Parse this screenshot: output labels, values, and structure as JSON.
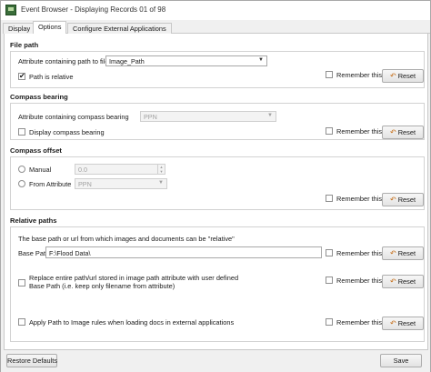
{
  "window": {
    "title": "Event Browser - Displaying Records 01 of 98",
    "app_icon": "app-icon"
  },
  "tabs": [
    {
      "label": "Display",
      "active": false
    },
    {
      "label": "Options",
      "active": true
    },
    {
      "label": "Configure External Applications",
      "active": false
    }
  ],
  "common": {
    "remember_label": "Remember this",
    "reset_label": "Reset",
    "reset_icon": "undo-icon"
  },
  "file_path": {
    "title": "File path",
    "attribute_label": "Attribute containing path to file",
    "attribute_value": "Image_Path",
    "relative_label": "Path is relative",
    "relative_checked": true
  },
  "compass_bearing": {
    "title": "Compass bearing",
    "attribute_label": "Attribute containing compass bearing",
    "attribute_value": "PPN",
    "display_label": "Display compass bearing",
    "display_checked": false
  },
  "compass_offset": {
    "title": "Compass offset",
    "manual_label": "Manual",
    "manual_value": "0.0",
    "from_attribute_label": "From Attribute",
    "from_attribute_value": "PPN"
  },
  "relative_paths": {
    "title": "Relative paths",
    "description": "The base path or url from which images and documents can be \"relative\"",
    "base_path_label": "Base Path",
    "base_path_value": "F:\\Flood Data\\",
    "replace_label_line1": "Replace entire path/url stored in image path attribute with user defined",
    "replace_label_line2": "Base Path (i.e. keep only filename from attribute)",
    "apply_label": "Apply Path to Image rules when loading docs in external applications"
  },
  "footer": {
    "restore_label": "Restore Defaults",
    "save_label": "Save"
  }
}
